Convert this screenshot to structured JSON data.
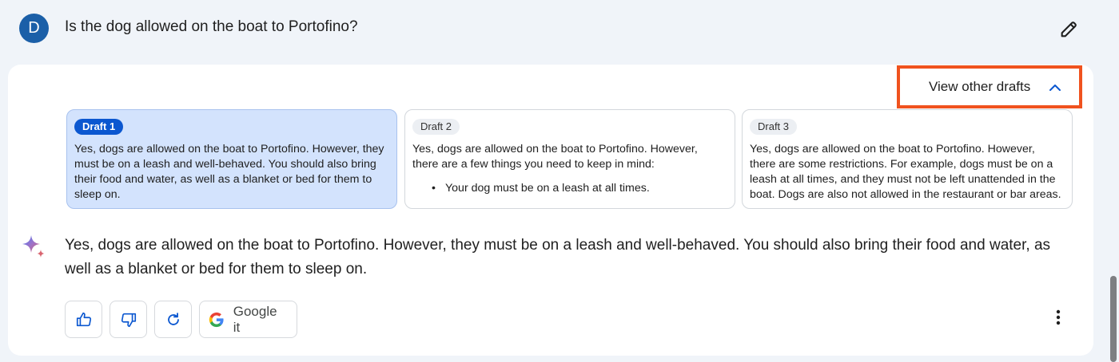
{
  "prompt": {
    "avatar_initial": "D",
    "text": "Is the dog allowed on the boat to Portofino?",
    "edit_icon": "pencil-icon"
  },
  "drafts_toggle": {
    "label": "View other drafts",
    "icon": "chevron-up-icon",
    "highlight_color": "#f0521e"
  },
  "drafts": [
    {
      "label": "Draft 1",
      "selected": true,
      "text": "Yes, dogs are allowed on the boat to Portofino. However, they must be on a leash and well-behaved. You should also bring their food and water, as well as a blanket or bed for them to sleep on."
    },
    {
      "label": "Draft 2",
      "selected": false,
      "text": "Yes, dogs are allowed on the boat to Portofino. However, there are a few things you need to keep in mind:",
      "bullet": "Your dog must be on a leash at all times."
    },
    {
      "label": "Draft 3",
      "selected": false,
      "text": "Yes, dogs are allowed on the boat to Portofino. However, there are some restrictions. For example, dogs must be on a leash at all times, and they must not be left unattended in the boat. Dogs are also not allowed in the restaurant or bar areas."
    }
  ],
  "response": {
    "icon": "sparkle-icon",
    "text": "Yes, dogs are allowed on the boat to Portofino. However, they must be on a leash and well-behaved. You should also bring their food and water, as well as a blanket or bed for them to sleep on."
  },
  "actions": {
    "thumbs_up_icon": "thumbs-up-icon",
    "thumbs_down_icon": "thumbs-down-icon",
    "regenerate_icon": "refresh-icon",
    "google_it_label": "Google it",
    "more_icon": "more-vertical-icon"
  },
  "colors": {
    "accent": "#0b57d0",
    "selected_draft_bg": "#d3e3fd",
    "page_bg": "#f0f4f9",
    "avatar_bg": "#1b5fa8"
  }
}
